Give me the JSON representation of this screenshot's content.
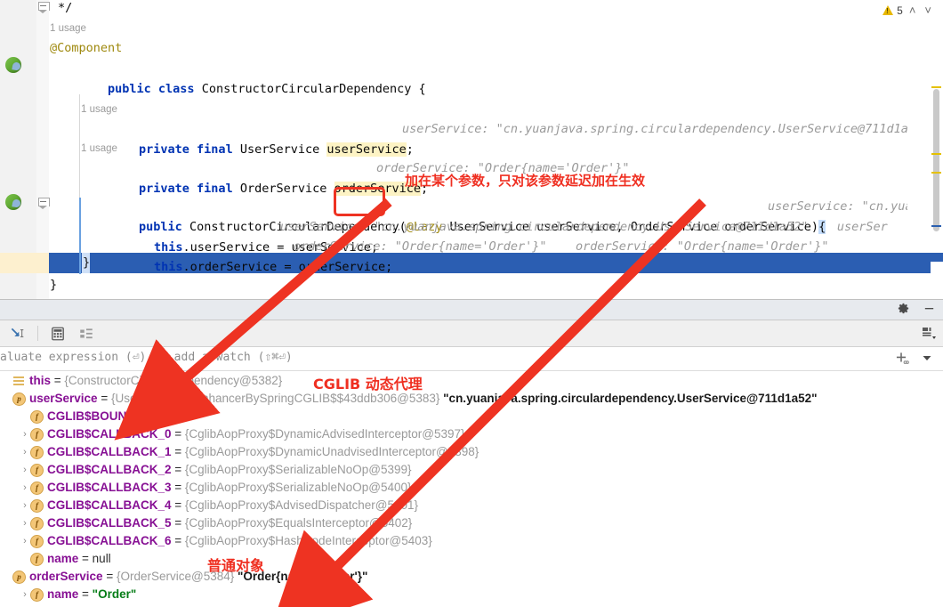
{
  "editor": {
    "lines": [
      {
        "id": "l1",
        "text": "*/",
        "indent": 0
      },
      {
        "id": "l2",
        "text": "1 usage",
        "type": "usage"
      },
      {
        "id": "l3",
        "text": "@Component",
        "type": "annotation"
      },
      {
        "id": "l4a",
        "text": "public class",
        "type": "keyword"
      },
      {
        "id": "l4b",
        "text": " ConstructorCircularDependency {"
      },
      {
        "id": "l5",
        "text": "1 usage",
        "type": "usage"
      },
      {
        "id": "l6a",
        "text": "private final",
        "type": "keyword"
      },
      {
        "id": "l6b",
        "text": " UserService "
      },
      {
        "id": "l6c",
        "text": "userService",
        "type": "highlight"
      },
      {
        "id": "l6d",
        "text": ";"
      },
      {
        "id": "l6hint",
        "text": "userService: \"cn.yuanjava.spring.circulardependency.UserService@711d1a52\"",
        "type": "hint"
      },
      {
        "id": "l7",
        "text": "1 usage",
        "type": "usage"
      },
      {
        "id": "l8a",
        "text": "private final",
        "type": "keyword"
      },
      {
        "id": "l8b",
        "text": " OrderService "
      },
      {
        "id": "l8c",
        "text": "orderService",
        "type": "highlight"
      },
      {
        "id": "l8d",
        "text": ";"
      },
      {
        "id": "l8hint",
        "text": "orderService: \"Order{name='Order'}\"",
        "type": "hint"
      },
      {
        "id": "l9kw",
        "text": "public",
        "type": "keyword"
      },
      {
        "id": "l9a",
        "text": " ConstructorCircularDependency("
      },
      {
        "id": "l9lazy",
        "text": "@Lazy",
        "type": "annotation"
      },
      {
        "id": "l9b",
        "text": " UserService userService, OrderService orderService)"
      },
      {
        "id": "l9brace",
        "text": "{"
      },
      {
        "id": "l9hint",
        "text": "userService: \"cn.yuanjav",
        "type": "hint"
      },
      {
        "id": "l10this",
        "text": "this",
        "type": "keyword"
      },
      {
        "id": "l10a",
        ".": "",
        "text": ".userService = userService;"
      },
      {
        "id": "l10hint",
        "text": "userService: \"cn.yuanjava.spring.circulardependency.UserService@711d1a52\"    userSer",
        "type": "hint"
      },
      {
        "id": "l11this",
        "text": "this",
        "type": "keyword"
      },
      {
        "id": "l11a",
        "text": ".orderService = orderService;"
      },
      {
        "id": "l11hint",
        "text": "orderService: \"Order{name='Order'}\"    orderService: \"Order{name='Order'}\"",
        "type": "hint"
      },
      {
        "id": "l12",
        "text": "}",
        "type": "selected"
      },
      {
        "id": "l13",
        "text": "}"
      }
    ],
    "code": {
      "comment_end": "*/",
      "usage_label": "1 usage",
      "component_annotation": "@Component",
      "class_decl_kw": "public class",
      "class_decl_name": " ConstructorCircularDependency {",
      "field1_kw": "private final",
      "field1_type": " UserService ",
      "field1_name": "userService",
      "field1_semi": ";",
      "field1_hint": "userService: \"cn.yuanjava.spring.circulardependency.UserService@711d1a52\"",
      "field2_kw": "private final",
      "field2_type": " OrderService ",
      "field2_name": "orderService",
      "field2_semi": ";",
      "field2_hint": "orderService: \"Order{name='Order'}\"",
      "ctor_kw": "public",
      "ctor_name": " ConstructorCircularDependency(",
      "ctor_lazy": "@Lazy",
      "ctor_params": " UserService userService, OrderService orderService)",
      "ctor_brace": "{",
      "ctor_hint": "userService: \"cn.yuanjav",
      "assign1_this": "this",
      "assign1_rest": ".userService = userService;",
      "assign1_hint": "userService: \"cn.yuanjava.spring.circulardependency.UserService@711d1a52\"    userSer",
      "assign2_this": "this",
      "assign2_rest": ".orderService = orderService;",
      "assign2_hint": "orderService: \"Order{name='Order'}\"    orderService: \"Order{name='Order'}\"",
      "close_brace_inner": "}",
      "close_brace_outer": "}"
    },
    "inspection": {
      "count": "5",
      "up_chevron": "˄",
      "down_chevron": "˅"
    }
  },
  "debugger": {
    "evaluate_placeholder": "aluate expression (⏎) or add a watch (⇧⌘⏎)",
    "toolbar": {
      "jump_to_source": "jump-to-source",
      "calculator": "evaluate-expression",
      "layout": "customize-view"
    },
    "variables": [
      {
        "depth": 0,
        "arrow": "",
        "icon": "list",
        "name": "this",
        "eq": " = ",
        "value": "{ConstructorCircularDependency@5382}",
        "str": ""
      },
      {
        "depth": 0,
        "arrow": "",
        "icon": "p",
        "name": "userService",
        "eq": " = ",
        "value": "{UserService$$EnhancerBySpringCGLIB$$43ddb306@5383}",
        "str": "\"cn.yuanjava.spring.circulardependency.UserService@711d1a52\""
      },
      {
        "depth": 1,
        "arrow": "",
        "icon": "f",
        "name": "CGLIB$BOUND",
        "eq": " = ",
        "value": "",
        "str": "",
        "literal": "false"
      },
      {
        "depth": 1,
        "arrow": "›",
        "icon": "f",
        "name": "CGLIB$CALLBACK_0",
        "eq": " = ",
        "value": "{CglibAopProxy$DynamicAdvisedInterceptor@5397}",
        "str": ""
      },
      {
        "depth": 1,
        "arrow": "›",
        "icon": "f",
        "name": "CGLIB$CALLBACK_1",
        "eq": " = ",
        "value": "{CglibAopProxy$DynamicUnadvisedInterceptor@5398}",
        "str": ""
      },
      {
        "depth": 1,
        "arrow": "›",
        "icon": "f",
        "name": "CGLIB$CALLBACK_2",
        "eq": " = ",
        "value": "{CglibAopProxy$SerializableNoOp@5399}",
        "str": ""
      },
      {
        "depth": 1,
        "arrow": "›",
        "icon": "f",
        "name": "CGLIB$CALLBACK_3",
        "eq": " = ",
        "value": "{CglibAopProxy$SerializableNoOp@5400}",
        "str": ""
      },
      {
        "depth": 1,
        "arrow": "›",
        "icon": "f",
        "name": "CGLIB$CALLBACK_4",
        "eq": " = ",
        "value": "{CglibAopProxy$AdvisedDispatcher@5401}",
        "str": ""
      },
      {
        "depth": 1,
        "arrow": "›",
        "icon": "f",
        "name": "CGLIB$CALLBACK_5",
        "eq": " = ",
        "value": "{CglibAopProxy$EqualsInterceptor@5402}",
        "str": ""
      },
      {
        "depth": 1,
        "arrow": "›",
        "icon": "f",
        "name": "CGLIB$CALLBACK_6",
        "eq": " = ",
        "value": "{CglibAopProxy$HashCodeInterceptor@5403}",
        "str": ""
      },
      {
        "depth": 1,
        "arrow": "",
        "icon": "f",
        "name": "name",
        "eq": " = ",
        "value": "",
        "str": "",
        "literal": "null"
      },
      {
        "depth": 0,
        "arrow": "",
        "icon": "p",
        "name": "orderService",
        "eq": " = ",
        "value": "{OrderService@5384}",
        "str": "\"Order{name='Order'}\""
      },
      {
        "depth": 1,
        "arrow": "›",
        "icon": "f",
        "name": "name",
        "eq": " = ",
        "value": "",
        "str": "",
        "green": "\"Order\""
      }
    ]
  },
  "annotations": {
    "lazy_note": "加在某个参数，只对该参数延迟加在生效",
    "cglib_note": "CGLIB 动态代理",
    "plain_note": "普通对象"
  },
  "colors": {
    "annotation_red": "#ef2f21",
    "keyword_blue": "#0033b3",
    "highlight_yellow": "#fdf3c4",
    "selection_blue": "#2b5eb2",
    "var_name_purple": "#871094",
    "string_green": "#067d17"
  }
}
